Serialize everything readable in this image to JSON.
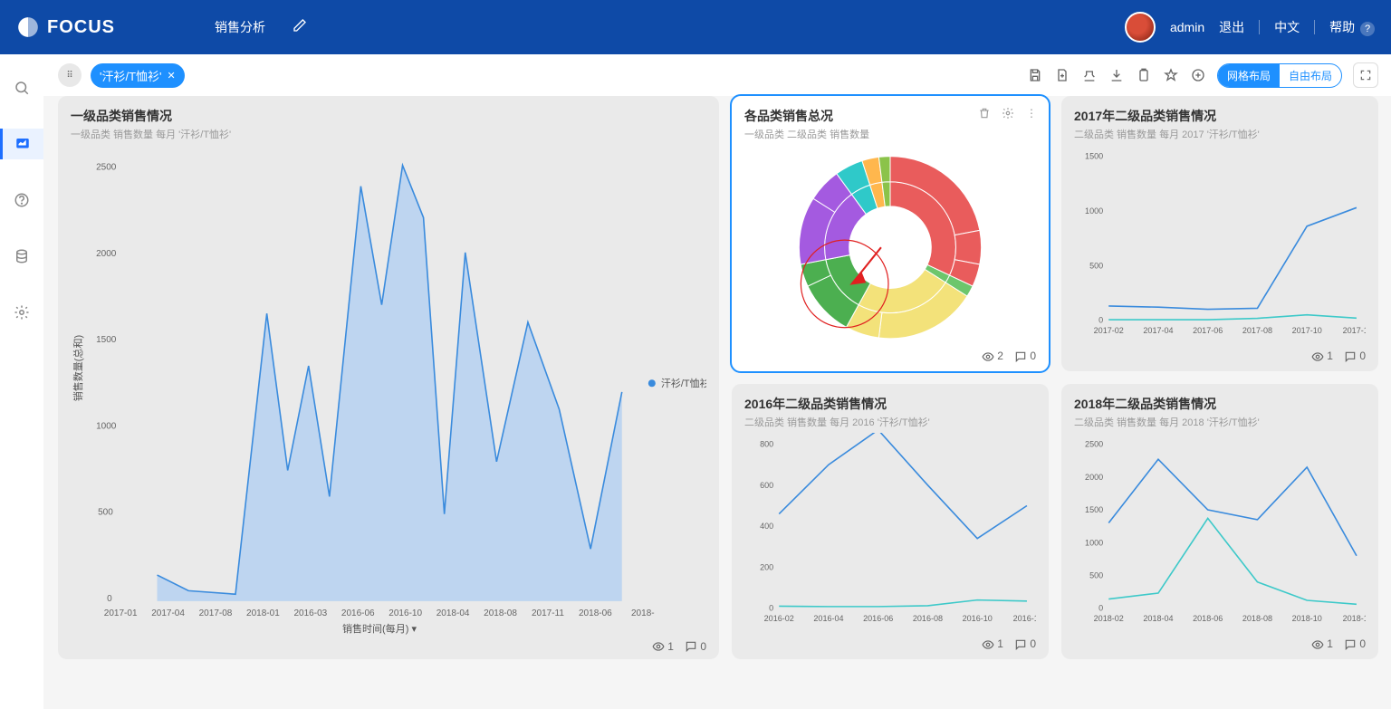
{
  "app": {
    "name": "FOCUS"
  },
  "top": {
    "tab": "销售分析",
    "user": "admin",
    "logout": "退出",
    "lang": "中文",
    "help": "帮助"
  },
  "toolbar": {
    "chip": "'汗衫/T恤衫'",
    "layout_grid": "网格布局",
    "layout_free": "自由布局"
  },
  "panel1": {
    "title": "一级品类销售情况",
    "sub": "一级品类 销售数量 每月 '汗衫/T恤衫'",
    "legend": "汗衫/T恤衫",
    "ylabel": "销售数量(总和)",
    "xlabel": "销售时间(每月)",
    "views": "1",
    "comments": "0"
  },
  "panel2": {
    "title": "各品类销售总况",
    "sub": "一级品类 二级品类 销售数量",
    "views": "2",
    "comments": "0"
  },
  "panel3": {
    "title": "2017年二级品类销售情况",
    "sub": "二级品类 销售数量 每月 2017 '汗衫/T恤衫'",
    "views": "1",
    "comments": "0"
  },
  "panel4": {
    "title": "2016年二级品类销售情况",
    "sub": "二级品类 销售数量 每月 2016 '汗衫/T恤衫'",
    "views": "1",
    "comments": "0"
  },
  "panel5": {
    "title": "2018年二级品类销售情况",
    "sub": "二级品类 销售数量 每月 2018 '汗衫/T恤衫'",
    "views": "1",
    "comments": "0"
  },
  "chart_data": [
    {
      "type": "area",
      "title": "一级品类销售情况",
      "xlabel": "销售时间(每月)",
      "ylabel": "销售数量(总和)",
      "ylim": [
        0,
        2500
      ],
      "categories": [
        "2017-01",
        "2017-04",
        "2017-08",
        "2018-01",
        "2016-03",
        "2016-06",
        "2016-10",
        "2018-04",
        "2018-08",
        "2017-11",
        "2018-06",
        "2018-"
      ],
      "series": [
        {
          "name": "汗衫/T恤衫",
          "values": [
            280,
            80,
            1500,
            1100,
            900,
            2380,
            2500,
            500,
            1600,
            800,
            300,
            1200
          ]
        }
      ]
    },
    {
      "type": "pie",
      "title": "各品类销售总况",
      "series": [
        {
          "name": "outer",
          "values": [
            {
              "v": 22,
              "c": "#e95c5c"
            },
            {
              "v": 6,
              "c": "#e95c5c"
            },
            {
              "v": 4,
              "c": "#e95c5c"
            },
            {
              "v": 2,
              "c": "#6cc66c"
            },
            {
              "v": 18,
              "c": "#f3e27a"
            },
            {
              "v": 6,
              "c": "#f3e27a"
            },
            {
              "v": 10,
              "c": "#4caf50"
            },
            {
              "v": 4,
              "c": "#4caf50"
            },
            {
              "v": 12,
              "c": "#a45ae0"
            },
            {
              "v": 6,
              "c": "#a45ae0"
            },
            {
              "v": 5,
              "c": "#2fc9c9"
            },
            {
              "v": 3,
              "c": "#ffb74d"
            },
            {
              "v": 2,
              "c": "#8bc34a"
            }
          ]
        },
        {
          "name": "inner",
          "values": [
            {
              "v": 32,
              "c": "#e95c5c"
            },
            {
              "v": 2,
              "c": "#6cc66c"
            },
            {
              "v": 24,
              "c": "#f3e27a"
            },
            {
              "v": 14,
              "c": "#4caf50"
            },
            {
              "v": 18,
              "c": "#a45ae0"
            },
            {
              "v": 5,
              "c": "#2fc9c9"
            },
            {
              "v": 3,
              "c": "#ffb74d"
            },
            {
              "v": 2,
              "c": "#8bc34a"
            }
          ]
        }
      ]
    },
    {
      "type": "line",
      "title": "2017年二级品类销售情况",
      "ylim": [
        0,
        1500
      ],
      "categories": [
        "2017-02",
        "2017-04",
        "2017-06",
        "2017-08",
        "2017-10",
        "2017-1."
      ],
      "series": [
        {
          "name": "s1",
          "values": [
            130,
            120,
            100,
            110,
            860,
            1030
          ]
        },
        {
          "name": "s2",
          "values": [
            5,
            5,
            5,
            18,
            50,
            20
          ]
        }
      ]
    },
    {
      "type": "line",
      "title": "2016年二级品类销售情况",
      "ylim": [
        0,
        800
      ],
      "categories": [
        "2016-02",
        "2016-04",
        "2016-06",
        "2016-08",
        "2016-10",
        "2016-1."
      ],
      "series": [
        {
          "name": "s1",
          "values": [
            460,
            700,
            870,
            600,
            340,
            500
          ]
        },
        {
          "name": "s2",
          "values": [
            10,
            8,
            8,
            12,
            40,
            35
          ]
        }
      ]
    },
    {
      "type": "line",
      "title": "2018年二级品类销售情况",
      "ylim": [
        0,
        2500
      ],
      "categories": [
        "2018-02",
        "2018-04",
        "2018-06",
        "2018-08",
        "2018-10",
        "2018-1."
      ],
      "series": [
        {
          "name": "s1",
          "values": [
            1300,
            2270,
            1500,
            1350,
            2150,
            800
          ]
        },
        {
          "name": "s2",
          "values": [
            140,
            230,
            1370,
            400,
            120,
            60
          ]
        }
      ]
    }
  ]
}
